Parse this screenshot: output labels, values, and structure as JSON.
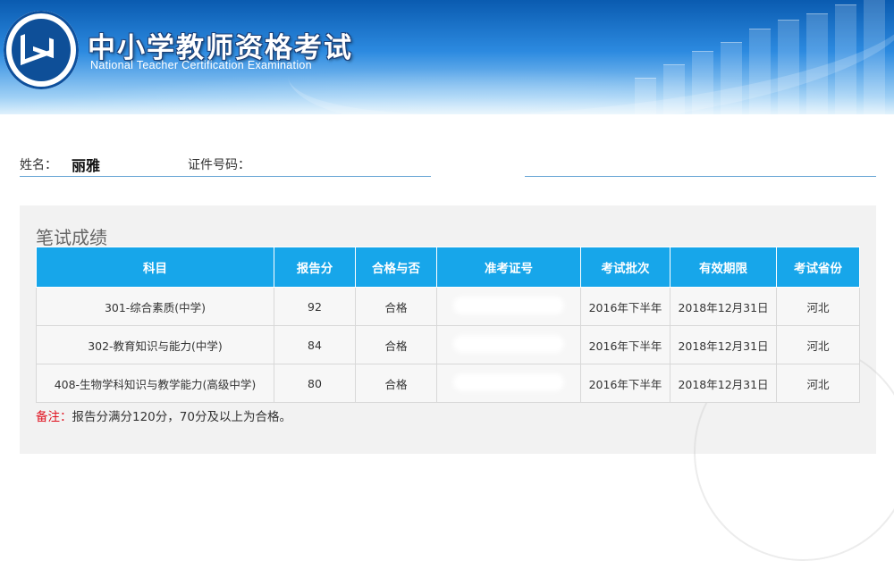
{
  "header": {
    "title_cn": "中小学教师资格考试",
    "title_en": "National Teacher Certification Examination"
  },
  "info": {
    "name_label": "姓名：",
    "name_value": "丽雅",
    "id_label": "证件号码："
  },
  "results": {
    "section_title": "笔试成绩",
    "columns": [
      "科目",
      "报告分",
      "合格与否",
      "准考证号",
      "考试批次",
      "有效期限",
      "考试省份"
    ],
    "rows": [
      {
        "subject": "301-综合素质(中学)",
        "score": "92",
        "pass": "合格",
        "batch": "2016年下半年",
        "valid": "2018年12月31日",
        "province": "河北"
      },
      {
        "subject": "302-教育知识与能力(中学)",
        "score": "84",
        "pass": "合格",
        "batch": "2016年下半年",
        "valid": "2018年12月31日",
        "province": "河北"
      },
      {
        "subject": "408-生物学科知识与教学能力(高级中学)",
        "score": "80",
        "pass": "合格",
        "batch": "2016年下半年",
        "valid": "2018年12月31日",
        "province": "河北"
      }
    ],
    "note_label": "备注：",
    "note_text": "报告分满分120分，70分及以上为合格。"
  },
  "colors": {
    "header_accent": "#17a6ea",
    "note_red": "#e0101e"
  }
}
